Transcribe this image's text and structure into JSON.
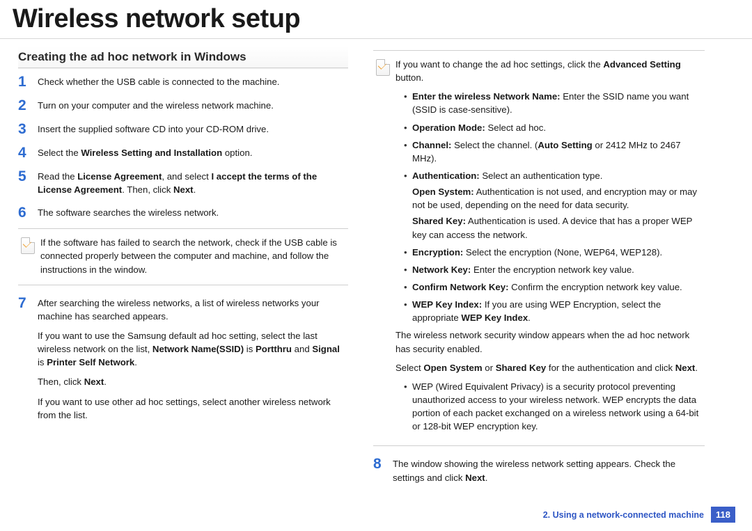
{
  "title": "Wireless network setup",
  "section_heading": "Creating the ad hoc network in Windows",
  "steps_left_a": [
    {
      "num": "1",
      "paras": [
        [
          {
            "t": "Check whether the USB cable is connected to the machine."
          }
        ]
      ]
    },
    {
      "num": "2",
      "paras": [
        [
          {
            "t": "Turn on your computer and the wireless network machine."
          }
        ]
      ]
    },
    {
      "num": "3",
      "paras": [
        [
          {
            "t": "Insert the supplied software CD into your CD-ROM drive."
          }
        ]
      ]
    },
    {
      "num": "4",
      "paras": [
        [
          {
            "t": "Select the "
          },
          {
            "b": "Wireless Setting and Installation"
          },
          {
            "t": " option."
          }
        ]
      ]
    },
    {
      "num": "5",
      "paras": [
        [
          {
            "t": "Read the "
          },
          {
            "b": "License Agreement"
          },
          {
            "t": ", and select "
          },
          {
            "b": "I accept the terms of the License Agreement"
          },
          {
            "t": ". Then, click "
          },
          {
            "b": "Next"
          },
          {
            "t": "."
          }
        ]
      ]
    },
    {
      "num": "6",
      "paras": [
        [
          {
            "t": "The software searches the wireless network."
          }
        ]
      ]
    }
  ],
  "note_left": [
    {
      "t": "If the software has failed to search the network, check if the USB cable is connected properly between the computer and machine, and follow the instructions in the window."
    }
  ],
  "step7": {
    "num": "7",
    "paras": [
      [
        {
          "t": "After searching the wireless networks, a list of wireless networks your machine has searched appears."
        }
      ],
      [
        {
          "t": "If you want to use the Samsung default ad hoc setting, select the last wireless network on the list, "
        },
        {
          "b": "Network Name(SSID)"
        },
        {
          "t": " is "
        },
        {
          "b": "Portthru"
        },
        {
          "t": " and "
        },
        {
          "b": "Signal"
        },
        {
          "t": " is "
        },
        {
          "b": "Printer Self Network"
        },
        {
          "t": "."
        }
      ],
      [
        {
          "t": "Then, click "
        },
        {
          "b": "Next"
        },
        {
          "t": "."
        }
      ],
      [
        {
          "t": "If you want to use other ad hoc settings, select another wireless network from the list."
        }
      ]
    ]
  },
  "note_right_intro": [
    {
      "t": "If you want to change the ad hoc settings, click the "
    },
    {
      "b": "Advanced Setting"
    },
    {
      "t": " button."
    }
  ],
  "note_right_bullets": [
    [
      {
        "b": "Enter the wireless Network Name:"
      },
      {
        "t": " Enter the SSID name you want (SSID is case-sensitive)."
      }
    ],
    [
      {
        "b": "Operation Mode:"
      },
      {
        "t": " Select ad hoc."
      }
    ],
    [
      {
        "b": "Channel:"
      },
      {
        "t": " Select the channel. ("
      },
      {
        "b": "Auto Setting"
      },
      {
        "t": " or 2412 MHz to 2467 MHz)."
      }
    ],
    [
      {
        "b": "Authentication:"
      },
      {
        "t": " Select an authentication type."
      }
    ],
    [
      {
        "b": "Encryption:"
      },
      {
        "t": " Select the encryption (None, WEP64, WEP128)."
      }
    ],
    [
      {
        "b": "Network Key:"
      },
      {
        "t": " Enter the encryption network key value."
      }
    ],
    [
      {
        "b": "Confirm Network Key:"
      },
      {
        "t": " Confirm the encryption network key value."
      }
    ],
    [
      {
        "b": "WEP Key Index:"
      },
      {
        "t": " If you are using WEP Encryption, select the appropriate "
      },
      {
        "b": "WEP Key Index"
      },
      {
        "t": "."
      }
    ]
  ],
  "auth_sub": [
    [
      {
        "b": "Open System:"
      },
      {
        "t": " Authentication is not used, and encryption may or may not be used, depending on the need for data security."
      }
    ],
    [
      {
        "b": "Shared Key:"
      },
      {
        "t": " Authentication is used. A device that has a proper WEP key can access the network."
      }
    ]
  ],
  "after_bullets": [
    [
      {
        "t": "The wireless network security window appears when the ad hoc network has security enabled."
      }
    ],
    [
      {
        "t": "Select "
      },
      {
        "b": "Open System"
      },
      {
        "t": " or "
      },
      {
        "b": "Shared Key"
      },
      {
        "t": " for the authentication and click "
      },
      {
        "b": "Next"
      },
      {
        "t": "."
      }
    ]
  ],
  "wep_bullet": [
    {
      "t": "WEP (Wired Equivalent Privacy) is a security protocol preventing unauthorized access to your wireless network. WEP encrypts the data portion of each packet exchanged on a wireless network using a 64-bit or 128-bit WEP encryption key."
    }
  ],
  "step8": {
    "num": "8",
    "paras": [
      [
        {
          "t": "The window showing the wireless network setting appears. Check the settings and click "
        },
        {
          "b": "Next"
        },
        {
          "t": "."
        }
      ]
    ]
  },
  "footer_chapter": "2.  Using a network-connected machine",
  "page_number": "118"
}
